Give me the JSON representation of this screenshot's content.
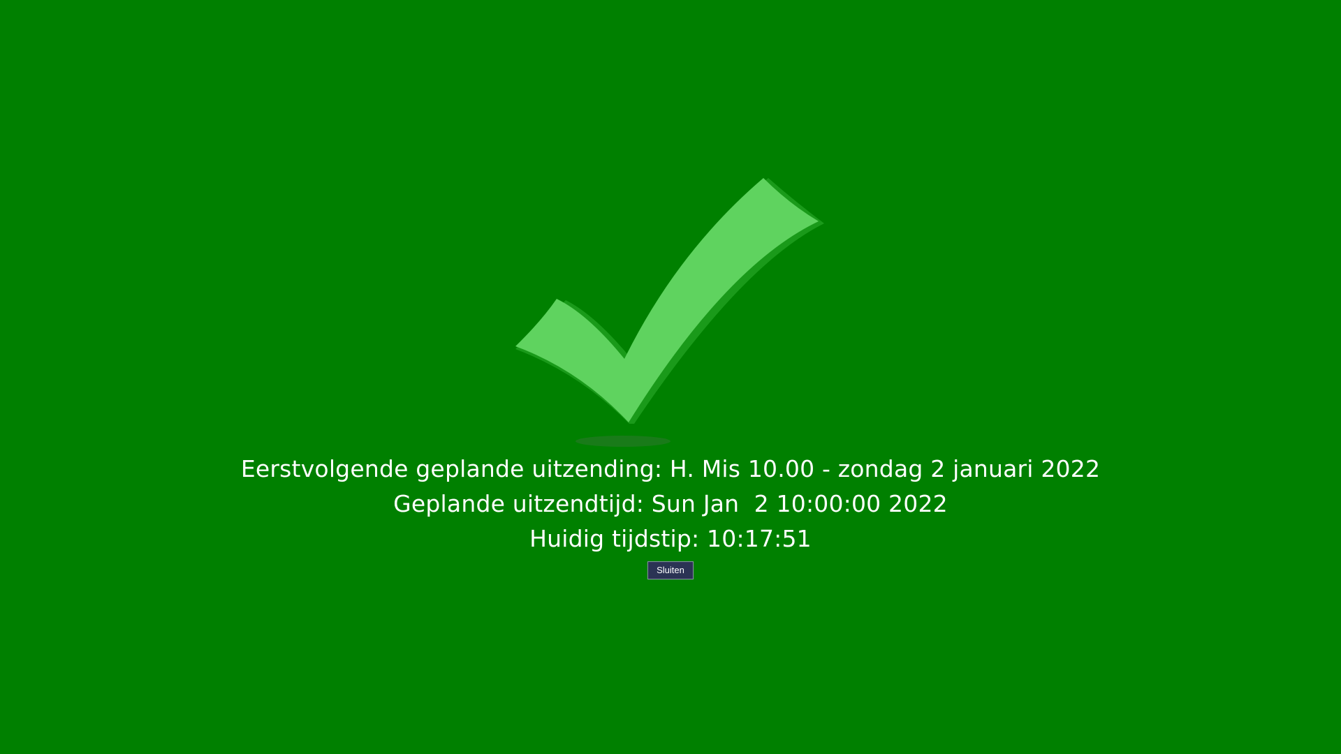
{
  "colors": {
    "background": "#008000",
    "check_fill": "#5fd35f",
    "check_edge": "#1a9a1a",
    "button_bg": "#2b3354",
    "text": "#ffffff"
  },
  "icon": "checkmark-icon",
  "info": {
    "next_broadcast": "Eerstvolgende geplande uitzending: H. Mis 10.00 - zondag 2 januari 2022",
    "planned_time": "Geplande uitzendtijd: Sun Jan  2 10:00:00 2022",
    "current_time": "Huidig tijdstip: 10:17:51"
  },
  "buttons": {
    "close_label": "Sluiten"
  }
}
